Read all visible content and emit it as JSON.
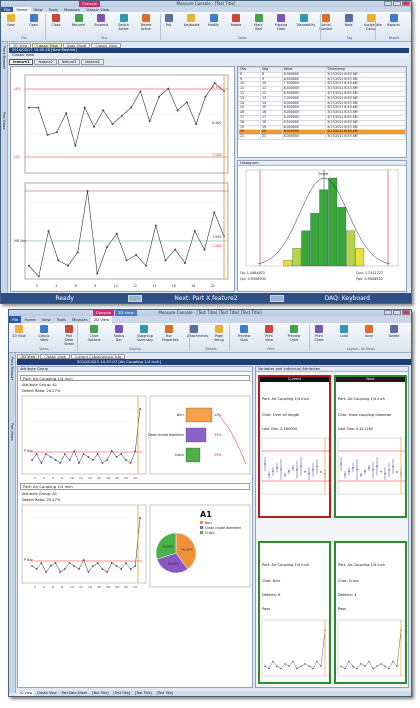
{
  "w1": {
    "title": "Measure Console - [Test Title]",
    "context_tab": "Console",
    "tabs": [
      "File",
      "Home",
      "View",
      "Tools",
      "Modules",
      "Classic View"
    ],
    "ribbon": {
      "buttons": [
        "New",
        "Open",
        "Close",
        "Resume",
        "Suspend",
        "Switch Active",
        "Delete Active",
        "Poll",
        "Keyboard",
        "Modify",
        "Rotate",
        "Mark Bad",
        "Missing Data",
        "Traceability",
        "Serial Number",
        "Note",
        "Assignable Cause",
        "Reports"
      ],
      "groups": [
        "File",
        "Run",
        "Data",
        "Tag",
        "Report"
      ]
    },
    "doc_tabs": [
      "2D View",
      "Classic View",
      "Data Sheet",
      "Classic View"
    ],
    "info_bar": "2010/03/17 15:09:58  [New Routine]",
    "view_label": "Classic View",
    "feature_tabs": [
      "feature1",
      "feature2",
      "feature3",
      "feature4"
    ],
    "side_tabs": [
      "Parts Browser",
      "Part Views"
    ],
    "xbar": {
      "ucl": "UCL",
      "lcl": "LCL",
      "ucl_val": "8.150",
      "lcl_val": "7.500",
      "cl_val": "8.400",
      "values": [
        8.6,
        8.6,
        8.1,
        8.15,
        8.5,
        7.9,
        8.6,
        8.25,
        8.55,
        8.3,
        8.45,
        8.6,
        8.9,
        8.35,
        8.8,
        8.95,
        8.55,
        8.7,
        8.3,
        8.8,
        9.05,
        8.9
      ]
    },
    "mr": {
      "label": "MR Bar",
      "ucl_val": "1.200",
      "cl_val": "1.990",
      "lcl_val": "0.000",
      "values": [
        0.25,
        0.05,
        0.9,
        0.35,
        0.25,
        0.5,
        1.65,
        0.1,
        0.6,
        0.85,
        0.35,
        0.45,
        0.25,
        1.0,
        0.35,
        0.55,
        0.3,
        0.9,
        0.55,
        1.25,
        0.8
      ]
    },
    "x_ticks": [
      "2",
      "4",
      "6",
      "8",
      "10",
      "12",
      "14",
      "16",
      "18",
      "20"
    ],
    "table": {
      "headers": [
        "Obs",
        "Sbg",
        "Value",
        "Timestamp"
      ],
      "rows": [
        [
          "8",
          "8",
          "8.000000",
          "3/17/2011 6:53 AM"
        ],
        [
          "9",
          "9",
          "8.500000",
          "3/17/2011 6:53 AM"
        ],
        [
          "10",
          "10",
          "7.500000",
          "3/17/2011 6:53 AM"
        ],
        [
          "11",
          "11",
          "8.400000",
          "3/17/2011 6:53 AM"
        ],
        [
          "12",
          "12",
          "8.500000",
          "3/17/2011 6:53 AM"
        ],
        [
          "13",
          "13",
          "7.000000",
          "3/17/2011 6:53 AM"
        ],
        [
          "14",
          "14",
          "8.000000",
          "3/17/2011 6:53 AM"
        ],
        [
          "15",
          "15",
          "8.500000",
          "3/17/2011 6:53 AM"
        ],
        [
          "16",
          "16",
          "8.000000",
          "3/17/2011 6:53 AM"
        ],
        [
          "17",
          "17",
          "8.000000",
          "3/17/2011 6:53 AM"
        ],
        [
          "18",
          "18",
          "8.500000",
          "3/17/2011 6:53 AM"
        ],
        [
          "19",
          "19",
          "8.000000",
          "3/17/2011 6:53 AM"
        ],
        [
          "20",
          "20",
          "8.000000",
          "3/17/2011 6:53 AM"
        ],
        [
          "21",
          "21",
          "8.000000",
          "3/17/2011 6:53 AM"
        ]
      ],
      "selected_row": 12
    },
    "hist": {
      "title": "Histogram",
      "target": "Target",
      "bars": [
        1,
        3,
        6,
        9,
        13,
        15,
        10,
        6,
        3
      ],
      "cp": "Cp: 1.0464922",
      "cpk_left": "Cpl: 0.9508932",
      "cpu": "Cpu: 1.2311727",
      "cpk": "Ppk: 0.9508932"
    },
    "status": {
      "left": "Ready",
      "mid": "Next: Part X.feature2",
      "right": "DAQ: Keyboard"
    }
  },
  "w2": {
    "title": "Measure Console - [Test Title]  [Test Title]  [Test Title]",
    "context_tab": "Console",
    "context_tab2": "2D View",
    "tabs": [
      "File",
      "Home",
      "View",
      "Tools",
      "Modules",
      "2D View"
    ],
    "ribbon": {
      "buttons": [
        "2D View",
        "Classic View",
        "Part Data Sheet",
        "Chart Options",
        "Status Bar",
        "Subgroup Summary",
        "Run Properties",
        "Attachments",
        "Page Setup",
        "Preview View",
        "Print View",
        "Preview Chart",
        "Print Chart",
        "Load",
        "Save",
        "Delete"
      ],
      "groups": [
        "Views",
        "Display",
        "Details",
        "Print",
        "Layout - All Views"
      ]
    },
    "doc_tabs": [
      "2D View",
      "Classic View",
      "Current Characteristic Info"
    ],
    "info_bar": "2010/03/29 14:37:07  [Air Coupling 1/4 inch]",
    "left_header": "Attribute Group",
    "right_header": "Variables and Individual Attributes",
    "side_tabs": [
      "Parts Browser",
      "Part Views"
    ],
    "g1": {
      "part": "Part: Air Coupling 1/4 inch",
      "group": "Attribute Group: A1",
      "ratio": "Defect Ratio: 20.27%",
      "label": "P Bar",
      "pareto": [
        "Burr",
        "Clean Inside diameter",
        "Crack"
      ],
      "pareto_pct": [
        "42%",
        "33%",
        "25%"
      ]
    },
    "g2": {
      "part": "Part: Air Coupling 1/4 inch",
      "group": "Attribute Group: A1",
      "ratio": "Defect Ratio: 20.27%",
      "label": "P Bar",
      "legend_title": "A1",
      "legend": [
        "Burr",
        "Clean inside diameter",
        "Crack"
      ],
      "pie_pct": [
        "40.00%",
        "30.00%",
        "30.00%"
      ]
    },
    "x_ticks": [
      "2",
      "4",
      "6",
      "8",
      "10",
      "12",
      "14",
      "16",
      "18",
      "20",
      "22",
      "24"
    ],
    "cards": [
      {
        "status": "Current",
        "part": "Part: Air Coupling 1/4 inch",
        "char": "Char: Over all length",
        "obs": "Last Obs: 2.160000"
      },
      {
        "status": "Next",
        "part": "Part: Air Coupling 1/4 inch",
        "char": "Char: Hose coupling diameter",
        "obs": "Last Obs: 0.411160"
      },
      {
        "status": "",
        "part": "Part: Air Coupling 1/4 inch",
        "char": "Char: Burr",
        "obs": "Defects: 6",
        "res": "Pass"
      },
      {
        "status": "",
        "part": "Part: Air Coupling 1/4 inch",
        "char": "Char: Crack",
        "obs": "Defects: 3",
        "res": "Pass"
      }
    ],
    "status_tabs": [
      "2D View",
      "Classic View",
      "Part Data Sheet",
      "[Test Title]",
      "[Test Title]",
      "[Test Title]",
      "[Test Title]"
    ]
  }
}
